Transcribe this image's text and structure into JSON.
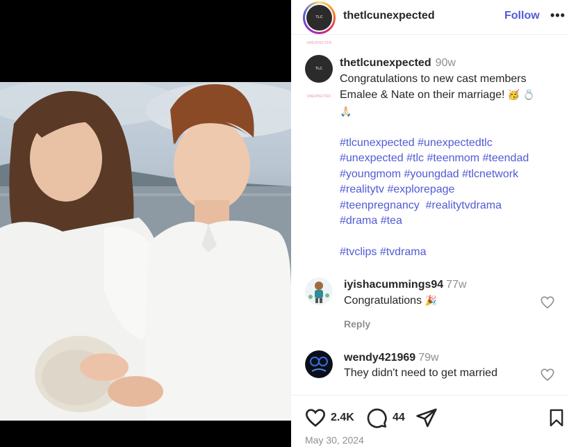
{
  "post": {
    "image_alt": "Couple in white clothes by the water showing wedding rings",
    "account": {
      "username": "thetlcunexpected",
      "logo_text": "TLC UNEXPECTED",
      "follow_label": "Follow",
      "more_label": "•••"
    },
    "caption": {
      "username": "thetlcunexpected",
      "time": "90w",
      "text_line1": "Congratulations to new cast members",
      "text_line2": "Emalee & Nate on their marriage!",
      "emoji1": "🥳",
      "emoji2": "💍",
      "emoji3": "🙏🏻",
      "hashtags_line1": [
        "#tlcunexpected",
        "#unexpectedtlc"
      ],
      "hashtags_line2": [
        "#unexpected",
        "#tlc",
        "#teenmom",
        "#teendad"
      ],
      "hashtags_line3": [
        "#youngmom",
        "#youngdad",
        "#tlcnetwork"
      ],
      "hashtags_line4": [
        "#realitytv",
        "#explorepage"
      ],
      "hashtags_line5": [
        "#teenpregnancy",
        "#realitytvdrama"
      ],
      "hashtags_line6": [
        "#drama",
        "#tea"
      ],
      "hashtags_line7": [
        "#tvclips",
        "#tvdrama"
      ]
    },
    "comments": [
      {
        "username": "iyishacummings94",
        "time": "77w",
        "text": "Congratulations",
        "emoji": "🎉",
        "reply_label": "Reply"
      },
      {
        "username": "wendy421969",
        "time": "79w",
        "text": "They didn't need to get married"
      }
    ],
    "actions": {
      "likes": "2.4K",
      "comments": "44",
      "date": "May 30, 2024"
    }
  },
  "colors": {
    "link": "#4f5bd5",
    "muted": "#8e8e8e",
    "text": "#262626"
  },
  "icons": [
    "heart-icon",
    "comment-icon",
    "share-icon",
    "bookmark-icon",
    "more-icon"
  ]
}
